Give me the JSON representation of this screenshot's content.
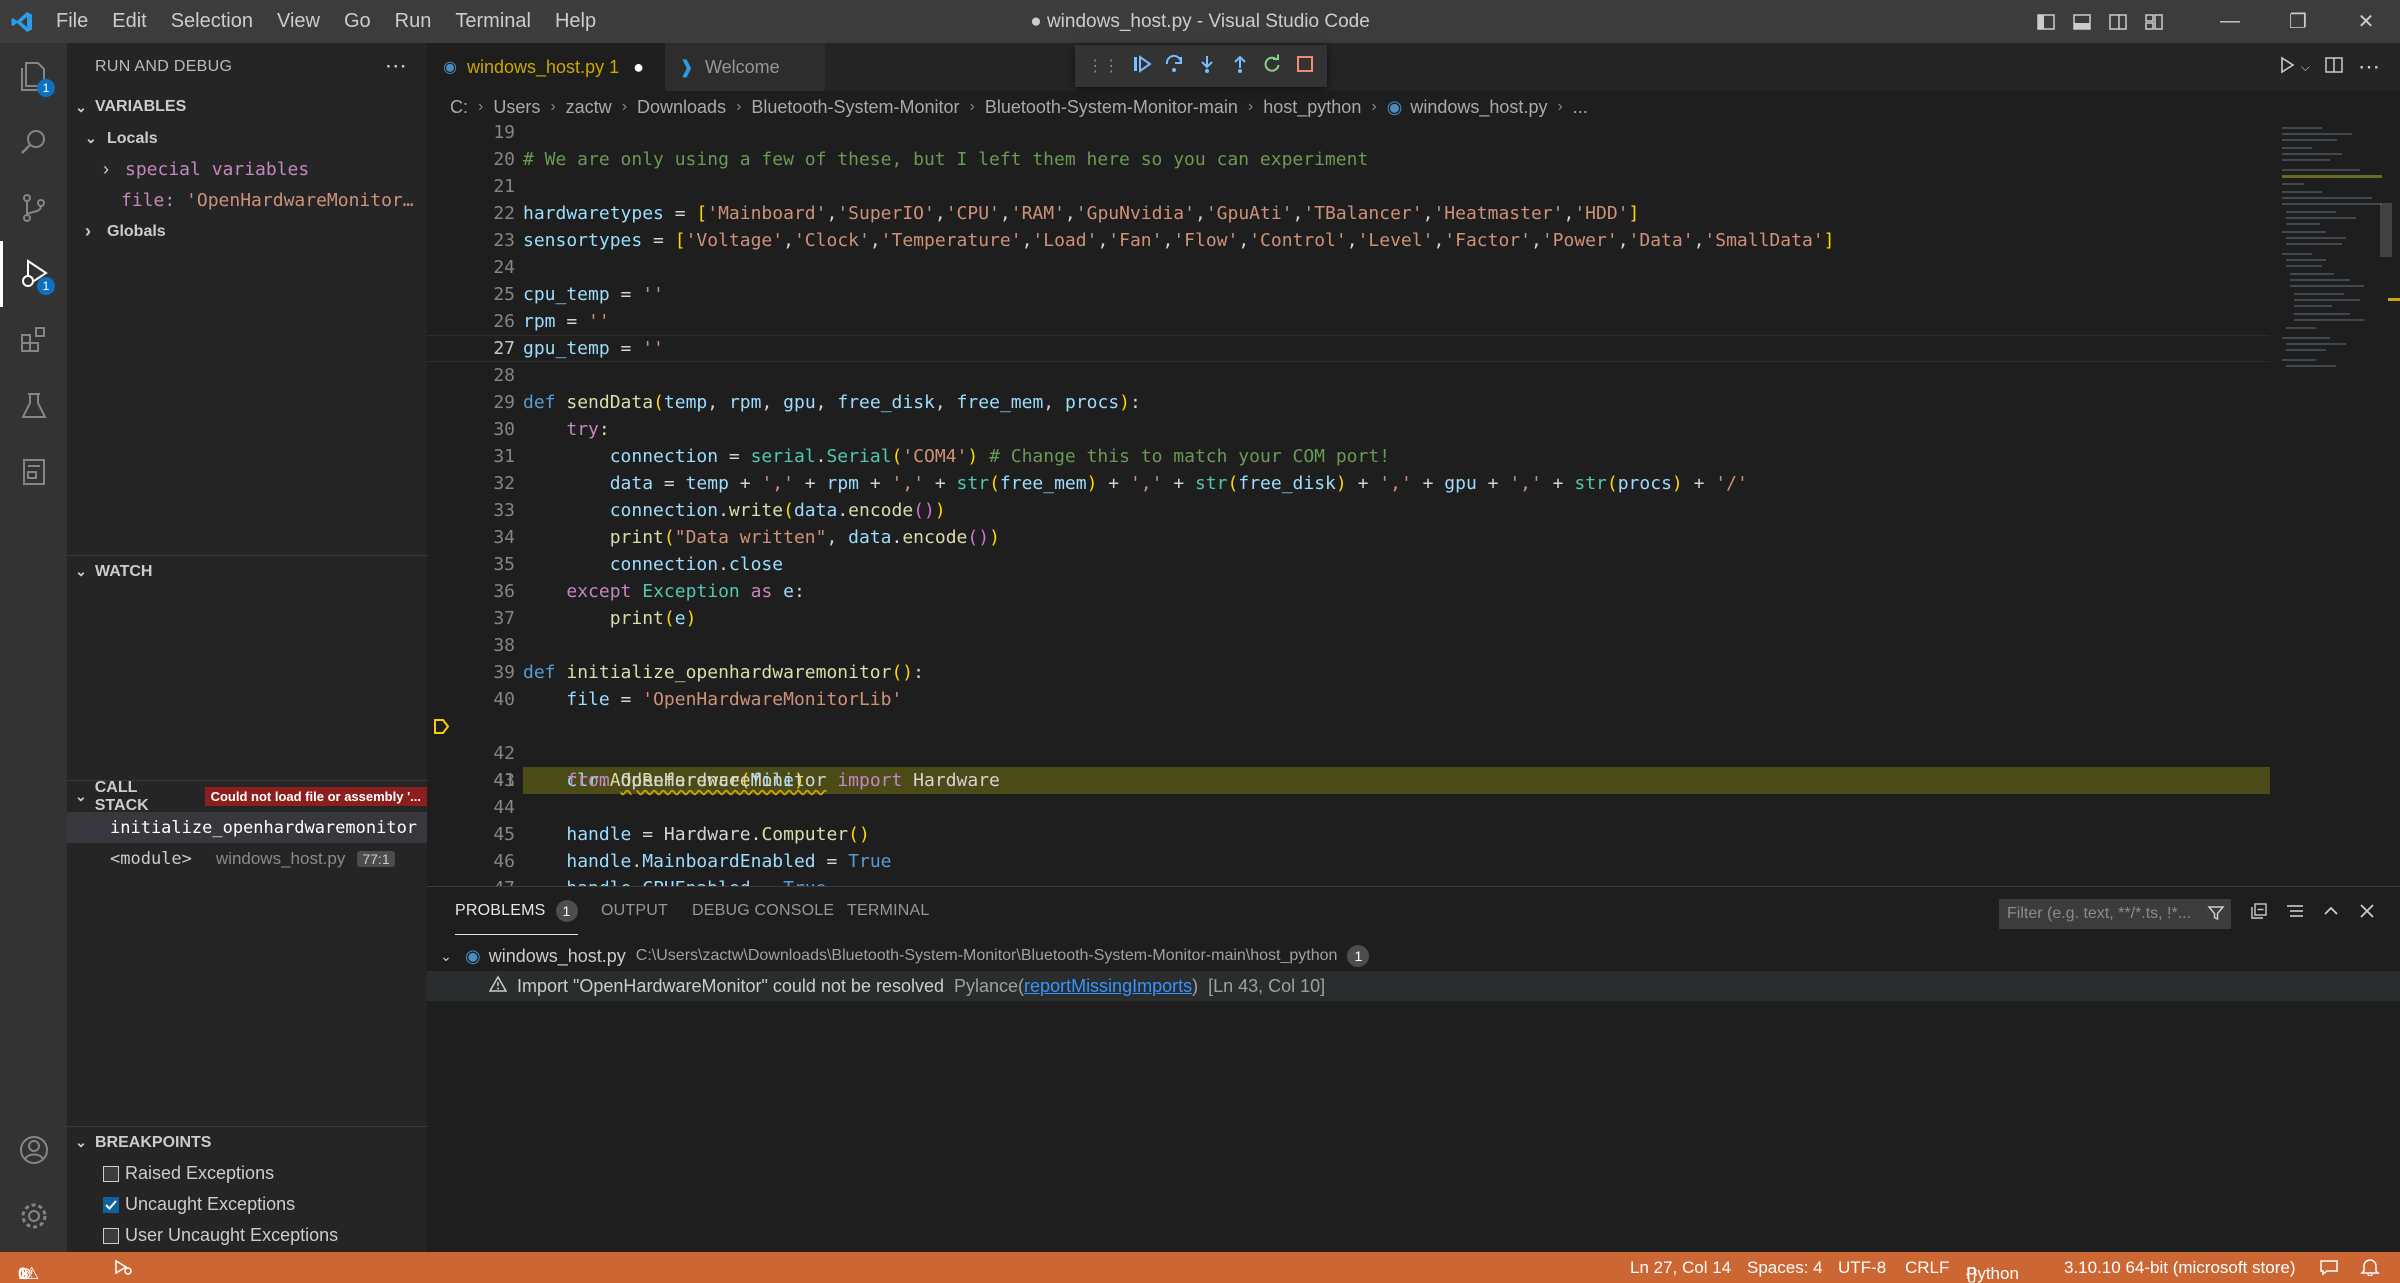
{
  "titlebar": {
    "menu": [
      "File",
      "Edit",
      "Selection",
      "View",
      "Go",
      "Run",
      "Terminal",
      "Help"
    ],
    "window_title": "● windows_host.py - Visual Studio Code"
  },
  "activity": {
    "explorer_badge": "1",
    "debug_badge": "1"
  },
  "sidebar": {
    "header": "RUN AND DEBUG",
    "variables": {
      "title": "VARIABLES",
      "locals": "Locals",
      "special": "special variables",
      "file_name": "file:",
      "file_value": "'OpenHardwareMonitorLib'",
      "globals": "Globals"
    },
    "watch": {
      "title": "WATCH"
    },
    "callstack": {
      "title": "CALL STACK",
      "badge": "Could not load file or assembly '...",
      "frames": [
        {
          "name": "initialize_openhardwaremonitor",
          "file": "",
          "pos": ""
        },
        {
          "name": "<module>",
          "file": "windows_host.py",
          "pos": "77:1"
        }
      ]
    },
    "breakpoints": {
      "title": "BREAKPOINTS",
      "items": [
        {
          "label": "Raised Exceptions",
          "checked": false
        },
        {
          "label": "Uncaught Exceptions",
          "checked": true
        },
        {
          "label": "User Uncaught Exceptions",
          "checked": false
        }
      ]
    }
  },
  "editor": {
    "tabs": [
      {
        "label": "windows_host.py 1",
        "modified_dot": "●"
      },
      {
        "label": "Welcome"
      }
    ],
    "breadcrumb": [
      "C:",
      "Users",
      "zactw",
      "Downloads",
      "Bluetooth-System-Monitor",
      "Bluetooth-System-Monitor-main",
      "host_python",
      "windows_host.py",
      "..."
    ],
    "line_numbers": [
      "19",
      "20",
      "21",
      "22",
      "23",
      "24",
      "25",
      "26",
      "27",
      "28",
      "29",
      "30",
      "31",
      "32",
      "33",
      "34",
      "35",
      "36",
      "37",
      "38",
      "39",
      "40",
      "41",
      "42",
      "43",
      "44",
      "45",
      "46",
      "47"
    ],
    "current_line": "27",
    "paused_line": "41"
  },
  "panel": {
    "tabs": [
      "PROBLEMS",
      "OUTPUT",
      "DEBUG CONSOLE",
      "TERMINAL"
    ],
    "problems_count": "1",
    "filter_placeholder": "Filter (e.g. text, **/*.ts, !*...",
    "file": "windows_host.py",
    "path": "C:\\Users\\zactw\\Downloads\\Bluetooth-System-Monitor\\Bluetooth-System-Monitor-main\\host_python",
    "file_count": "1",
    "message": "Import \"OpenHardwareMonitor\" could not be resolved",
    "source": "Pylance",
    "code": "reportMissingImports",
    "location": "[Ln 43, Col 10]"
  },
  "statusbar": {
    "errors": "0",
    "warnings": "1",
    "position": "Ln 27, Col 14",
    "spaces": "Spaces: 4",
    "encoding": "UTF-8",
    "eol": "CRLF",
    "language": "Python",
    "interpreter": "3.10.10 64-bit (microsoft store)"
  },
  "colors": {
    "statusbar": "#cc6633",
    "accent": "#0e70c0",
    "paused_line": "#4b4b18"
  }
}
